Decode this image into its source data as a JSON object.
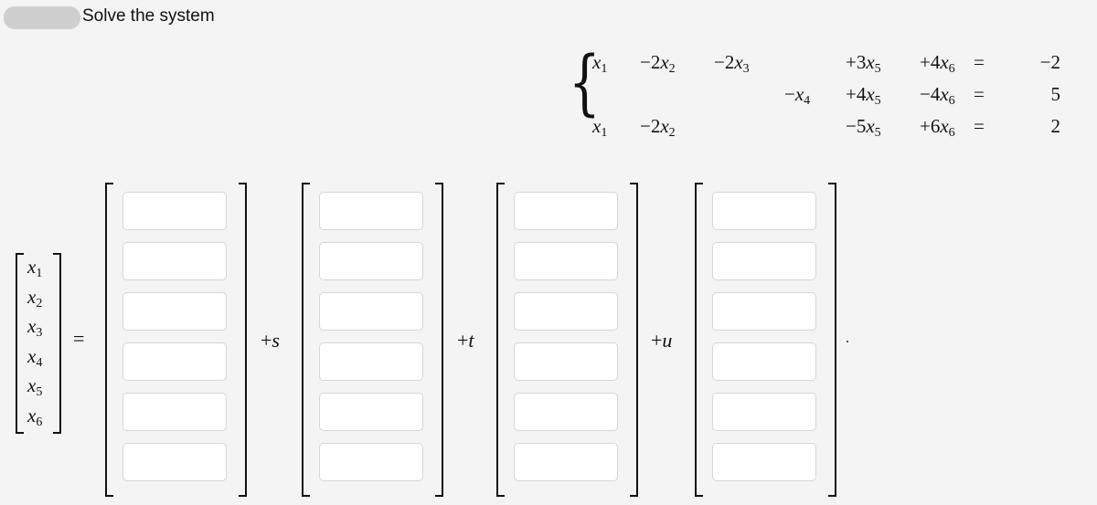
{
  "header": {
    "redacted_label": "",
    "title": "Solve the system"
  },
  "system": {
    "equations": [
      {
        "terms": [
          {
            "coef": "",
            "var": "x",
            "sub": "1"
          },
          {
            "coef": "−2",
            "var": "x",
            "sub": "2"
          },
          {
            "coef": "−2",
            "var": "x",
            "sub": "3"
          },
          null,
          {
            "coef": "+3",
            "var": "x",
            "sub": "5"
          },
          {
            "coef": "+4",
            "var": "x",
            "sub": "6"
          }
        ],
        "eq": "=",
        "rhs": "−2"
      },
      {
        "terms": [
          null,
          null,
          null,
          {
            "coef": "−",
            "var": "x",
            "sub": "4"
          },
          {
            "coef": "+4",
            "var": "x",
            "sub": "5"
          },
          {
            "coef": "−4",
            "var": "x",
            "sub": "6"
          }
        ],
        "eq": "=",
        "rhs": "5"
      },
      {
        "terms": [
          {
            "coef": "",
            "var": "x",
            "sub": "1"
          },
          {
            "coef": "−2",
            "var": "x",
            "sub": "2"
          },
          null,
          null,
          {
            "coef": "−5",
            "var": "x",
            "sub": "5"
          },
          {
            "coef": "+6",
            "var": "x",
            "sub": "6"
          }
        ],
        "eq": "=",
        "rhs": "2"
      }
    ]
  },
  "solution": {
    "variables": [
      {
        "var": "x",
        "sub": "1"
      },
      {
        "var": "x",
        "sub": "2"
      },
      {
        "var": "x",
        "sub": "3"
      },
      {
        "var": "x",
        "sub": "4"
      },
      {
        "var": "x",
        "sub": "5"
      },
      {
        "var": "x",
        "sub": "6"
      }
    ],
    "equals": "=",
    "vectors": [
      {
        "prefix": "",
        "param": "",
        "values": [
          "",
          "",
          "",
          "",
          "",
          ""
        ]
      },
      {
        "prefix": "+",
        "param": "s",
        "values": [
          "",
          "",
          "",
          "",
          "",
          ""
        ]
      },
      {
        "prefix": "+",
        "param": "t",
        "values": [
          "",
          "",
          "",
          "",
          "",
          ""
        ]
      },
      {
        "prefix": "+",
        "param": "u",
        "values": [
          "",
          "",
          "",
          "",
          "",
          ""
        ]
      }
    ],
    "terminator": "."
  }
}
